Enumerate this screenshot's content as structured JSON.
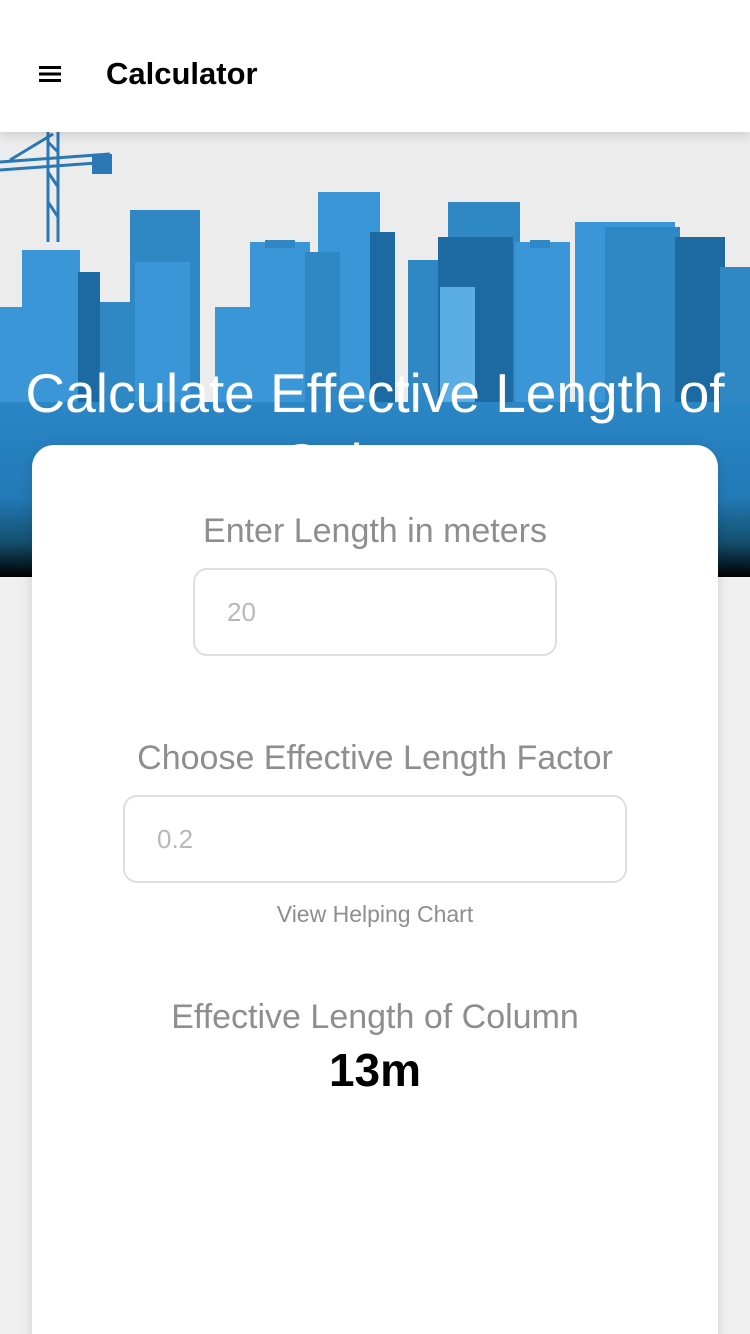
{
  "header": {
    "title": "Calculator",
    "menu_icon": "menu-icon"
  },
  "hero": {
    "title": "Calculate Effective Length of Column",
    "colors": {
      "building_light": "#3a96d6",
      "building_dark": "#1d6aa3",
      "crane": "#2a78b5"
    }
  },
  "form": {
    "length_label": "Enter Length in meters",
    "length_placeholder": "20",
    "factor_label": "Choose Effective Length Factor",
    "factor_placeholder": "0.2",
    "chart_link": "View Helping Chart"
  },
  "result": {
    "label": "Effective Length of Column",
    "value": "13m"
  }
}
